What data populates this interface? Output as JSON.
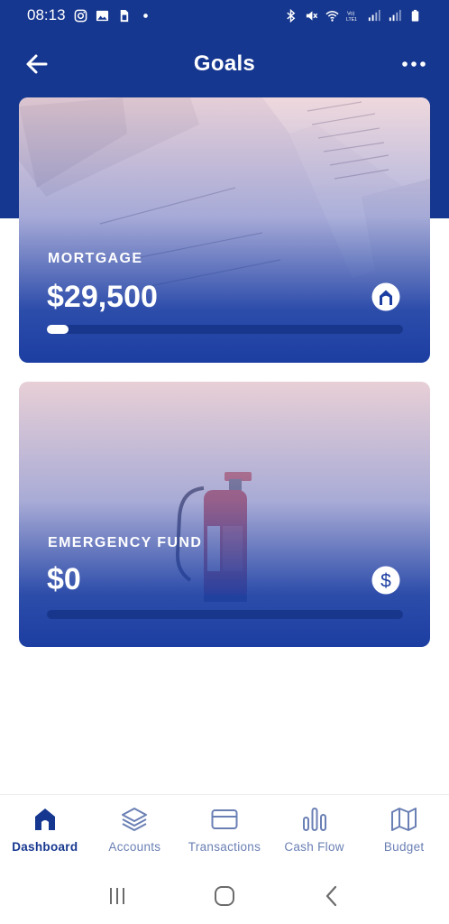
{
  "status_bar": {
    "time": "08:13",
    "left_icons": [
      "instagram-icon",
      "gallery-icon",
      "sim-icon",
      "dot-icon"
    ],
    "right_icons": [
      "bluetooth-icon",
      "mute-icon",
      "wifi-icon",
      "volte-icon",
      "signal-icon",
      "signal-icon",
      "battery-icon"
    ]
  },
  "header": {
    "title": "Goals",
    "back_icon": "arrow-left-icon",
    "more_icon": "more-dots-icon"
  },
  "goals": [
    {
      "name": "MORTGAGE",
      "amount": "$29,500",
      "icon": "house-icon",
      "progress": 0.06
    },
    {
      "name": "EMERGENCY FUND",
      "amount": "$0",
      "icon": "dollar-icon",
      "progress": 0
    }
  ],
  "bottom_nav": [
    {
      "label": "Dashboard",
      "icon": "home-icon",
      "active": true
    },
    {
      "label": "Accounts",
      "icon": "layers-icon",
      "active": false
    },
    {
      "label": "Transactions",
      "icon": "credit-card-icon",
      "active": false
    },
    {
      "label": "Cash Flow",
      "icon": "bar-chart-icon",
      "active": false
    },
    {
      "label": "Budget",
      "icon": "map-icon",
      "active": false
    }
  ],
  "colors": {
    "brand": "#16378f",
    "nav_inactive": "#6a7fb4",
    "progress_track": "#18378c"
  }
}
